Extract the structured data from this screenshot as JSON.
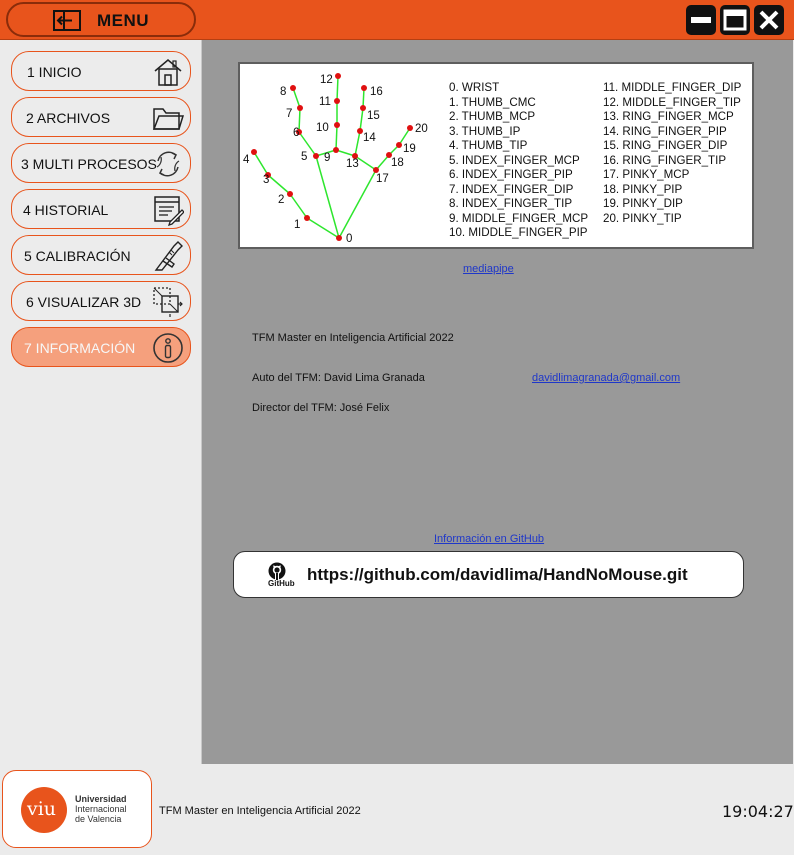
{
  "header": {
    "menu_label": "MENU",
    "icons": {
      "menu": "exit-sidebar-icon",
      "minimize": "minimize-icon",
      "maximize": "maximize-icon",
      "close": "close-icon"
    },
    "accent_color": "#e8541c"
  },
  "sidebar": {
    "items": [
      {
        "label": "1 INICIO",
        "icon": "home-icon",
        "active": false
      },
      {
        "label": "2 ARCHIVOS",
        "icon": "folder-icon",
        "active": false
      },
      {
        "label": "3 MULTI PROCESOS",
        "icon": "refresh-icon",
        "active": false
      },
      {
        "label": "4 HISTORIAL",
        "icon": "history-icon",
        "active": false
      },
      {
        "label": "5 CALIBRACIÓN",
        "icon": "caliper-icon",
        "active": false
      },
      {
        "label": "6 VISUALIZAR 3D",
        "icon": "3d-icon",
        "active": false
      },
      {
        "label": "7 INFORMACIÓN",
        "icon": "info-icon",
        "active": true
      }
    ],
    "active_color": "#f5a07d"
  },
  "main": {
    "hand_diagram": {
      "point_labels": [
        "0",
        "1",
        "2",
        "3",
        "4",
        "5",
        "6",
        "7",
        "8",
        "9",
        "10",
        "11",
        "12",
        "13",
        "14",
        "15",
        "16",
        "17",
        "18",
        "19",
        "20"
      ],
      "landmarks_col1": [
        "0. WRIST",
        "1. THUMB_CMC",
        "2. THUMB_MCP",
        "3. THUMB_IP",
        "4. THUMB_TIP",
        "5. INDEX_FINGER_MCP",
        "6. INDEX_FINGER_PIP",
        "7. INDEX_FINGER_DIP",
        "8. INDEX_FINGER_TIP",
        "9. MIDDLE_FINGER_MCP",
        "10. MIDDLE_FINGER_PIP"
      ],
      "landmarks_col2": [
        "11. MIDDLE_FINGER_DIP",
        "12. MIDDLE_FINGER_TIP",
        "13. RING_FINGER_MCP",
        "14. RING_FINGER_PIP",
        "15. RING_FINGER_DIP",
        "16. RING_FINGER_TIP",
        "17. PINKY_MCP",
        "18. PINKY_PIP",
        "19. PINKY_DIP",
        "20. PINKY_TIP"
      ],
      "line_color": "#2ee62e",
      "point_color": "#e01010"
    },
    "mediapipe_link": "mediapipe",
    "title": "TFM Master en Inteligencia Artificial 2022",
    "author": "Auto del TFM: David Lima Granada",
    "email": "davidlimagranada@gmail.com",
    "director": "Director del TFM: José Felix",
    "github_link": "Información en GitHub",
    "github_url": "https://github.com/davidlima/HandNoMouse.git",
    "github_word": "GitHub"
  },
  "footer": {
    "university_logo_text": "viu",
    "university_line1": "Universidad",
    "university_line2": "Internacional",
    "university_line3": "de Valencia",
    "caption": "TFM Master en Inteligencia Artificial 2022",
    "clock": "19:04:27"
  }
}
